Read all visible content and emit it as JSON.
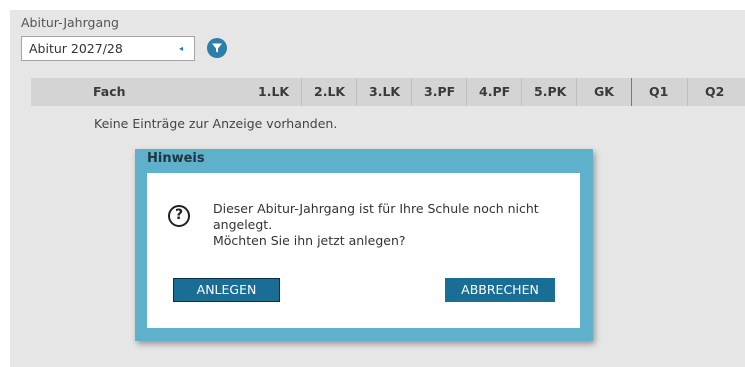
{
  "filter": {
    "label": "Abitur-Jahrgang",
    "selected_value": "Abitur 2027/28",
    "arrow_glyph": "◂",
    "filter_icon": "filter-icon"
  },
  "table": {
    "columns": [
      "Fach",
      "1.LK",
      "2.LK",
      "3.LK",
      "3.PF",
      "4.PF",
      "5.PK",
      "GK",
      "Q1",
      "Q2"
    ],
    "empty_message": "Keine Einträge zur Anzeige vorhanden."
  },
  "dialog": {
    "title": "Hinweis",
    "icon": "question-icon",
    "icon_glyph": "?",
    "message_line1": "Dieser Abitur-Jahrgang ist für Ihre Schule noch nicht angelegt.",
    "message_line2": "Möchten Sie ihn jetzt anlegen?",
    "ok_label": "ANLEGEN",
    "cancel_label": "ABBRECHEN"
  },
  "colors": {
    "accent": "#1a6e96",
    "dialog_frame": "#5eb0cb",
    "panel_bg": "#e6e6e6",
    "header_bg": "#d4d4d4"
  }
}
